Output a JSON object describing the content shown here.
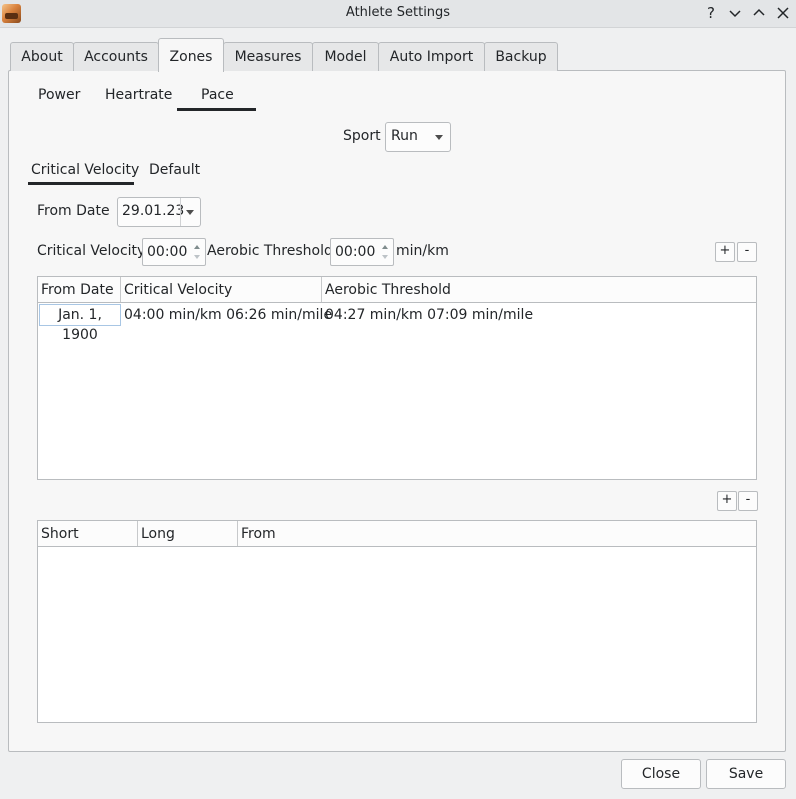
{
  "window": {
    "title": "Athlete Settings",
    "controls": {
      "help": "?",
      "minimize": "⌄",
      "maximize": "⌃",
      "close": "✕"
    }
  },
  "tabs": [
    "About",
    "Accounts",
    "Zones",
    "Measures",
    "Model",
    "Auto Import",
    "Backup"
  ],
  "active_tab": "Zones",
  "zone_tabs": [
    "Power",
    "Heartrate",
    "Pace"
  ],
  "active_zone_tab": "Pace",
  "sport": {
    "label": "Sport",
    "value": "Run"
  },
  "pace_tabs": [
    "Critical Velocity",
    "Default"
  ],
  "active_pace_tab": "Critical Velocity",
  "from_date": {
    "label": "From Date",
    "value": "29.01.23"
  },
  "critical_velocity": {
    "label": "Critical Velocity",
    "value": "00:00"
  },
  "aerobic_threshold": {
    "label": "Aerobic Threshold",
    "value": "00:00",
    "unit": "min/km"
  },
  "add_label": "+",
  "remove_label": "-",
  "cv_table": {
    "columns": [
      "From Date",
      "Critical Velocity",
      "Aerobic Threshold"
    ],
    "rows": [
      {
        "from_date": "Jan. 1, 1900",
        "critical_velocity": "04:00 min/km 06:26 min/mile",
        "aerobic_threshold": "04:27 min/km 07:09 min/mile"
      }
    ]
  },
  "zones_table": {
    "columns": [
      "Short",
      "Long",
      "From"
    ]
  },
  "buttons": {
    "close": "Close",
    "save": "Save"
  },
  "colors": {
    "accent_underline": "#232629",
    "background": "#eff0f1",
    "selection_border": "#a8c6e4"
  }
}
